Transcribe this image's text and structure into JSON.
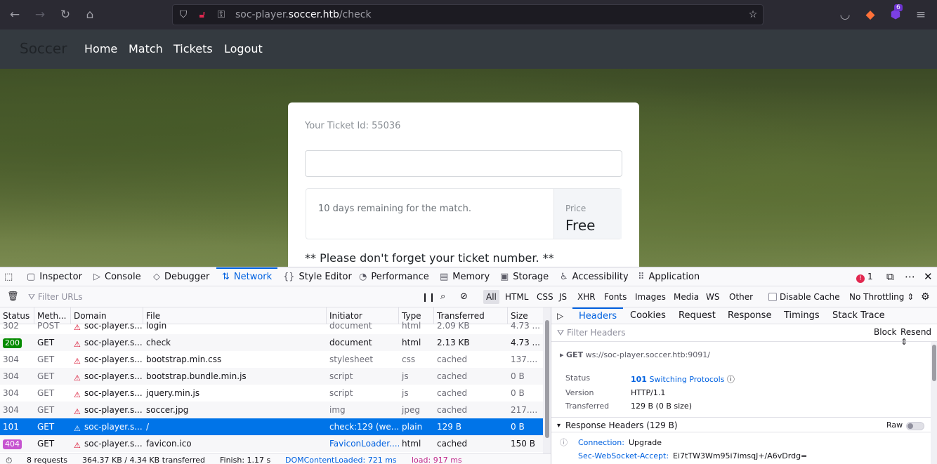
{
  "browser": {
    "url_prefix": "soc-player.",
    "url_domain": "soccer.htb",
    "url_path": "/check",
    "extension_badge": "6"
  },
  "site": {
    "brand": "Soccer",
    "nav": [
      "Home",
      "Match",
      "Tickets",
      "Logout"
    ],
    "ticket_id_text": "Your Ticket Id: 55036",
    "ticket_input_value": "",
    "remaining_text": "10 days remaining for the match.",
    "price_label": "Price",
    "price_value": "Free",
    "note": "** Please don't forget your ticket number. **"
  },
  "devtools": {
    "tabs": [
      {
        "label": "Inspector",
        "glyph": "▢"
      },
      {
        "label": "Console",
        "glyph": "▷"
      },
      {
        "label": "Debugger",
        "glyph": "◇"
      },
      {
        "label": "Network",
        "glyph": "⇅"
      },
      {
        "label": "Style Editor",
        "glyph": "{}"
      },
      {
        "label": "Performance",
        "glyph": "◔"
      },
      {
        "label": "Memory",
        "glyph": "▤"
      },
      {
        "label": "Storage",
        "glyph": "▣"
      },
      {
        "label": "Accessibility",
        "glyph": "♿"
      },
      {
        "label": "Application",
        "glyph": "⠿"
      }
    ],
    "active_tab": "Network",
    "error_count": "1",
    "filter_placeholder": "Filter URLs",
    "type_filters": [
      "All",
      "HTML",
      "CSS",
      "JS",
      "XHR",
      "Fonts",
      "Images",
      "Media",
      "WS",
      "Other"
    ],
    "disable_cache_label": "Disable Cache",
    "throttling": "No Throttling",
    "columns": [
      "Status",
      "Meth...",
      "Domain",
      "File",
      "Initiator",
      "Type",
      "Transferred",
      "Size"
    ],
    "requests": [
      {
        "status": "302",
        "method": "POST",
        "domain": "soc-player.s...",
        "file": "login",
        "initiator": "document",
        "type": "html",
        "transferred": "2.09 KB",
        "size": "4.73 ..."
      },
      {
        "status": "200",
        "method": "GET",
        "domain": "soc-player.s...",
        "file": "check",
        "initiator": "document",
        "type": "html",
        "transferred": "2.13 KB",
        "size": "4.73 ..."
      },
      {
        "status": "304",
        "method": "GET",
        "domain": "soc-player.s...",
        "file": "bootstrap.min.css",
        "initiator": "stylesheet",
        "type": "css",
        "transferred": "cached",
        "size": "137...."
      },
      {
        "status": "304",
        "method": "GET",
        "domain": "soc-player.s...",
        "file": "bootstrap.bundle.min.js",
        "initiator": "script",
        "type": "js",
        "transferred": "cached",
        "size": "0 B"
      },
      {
        "status": "304",
        "method": "GET",
        "domain": "soc-player.s...",
        "file": "jquery.min.js",
        "initiator": "script",
        "type": "js",
        "transferred": "cached",
        "size": "0 B"
      },
      {
        "status": "304",
        "method": "GET",
        "domain": "soc-player.s...",
        "file": "soccer.jpg",
        "initiator": "img",
        "type": "jpeg",
        "transferred": "cached",
        "size": "217...."
      },
      {
        "status": "101",
        "method": "GET",
        "domain": "soc-player.s...",
        "file": "/",
        "initiator": "check:129 (we...",
        "type": "plain",
        "transferred": "129 B",
        "size": "0 B"
      },
      {
        "status": "404",
        "method": "GET",
        "domain": "soc-player.s...",
        "file": "favicon.ico",
        "initiator": "FaviconLoader....",
        "type": "html",
        "transferred": "cached",
        "size": "150 B"
      }
    ],
    "status_bar": {
      "requests": "8 requests",
      "transferred": "364.37 KB / 4.34 KB transferred",
      "finish": "Finish: 1.17 s",
      "dcl": "DOMContentLoaded: 721 ms",
      "load": "load: 917 ms"
    },
    "panel": {
      "tabs": [
        "Headers",
        "Cookies",
        "Request",
        "Response",
        "Timings",
        "Stack Trace"
      ],
      "filter_placeholder": "Filter Headers",
      "block_label": "Block",
      "resend_label": "Resend",
      "method": "GET",
      "url": "ws://soc-player.soccer.htb:9091/",
      "status_label": "Status",
      "status_code": "101",
      "status_text": "Switching Protocols",
      "version_label": "Version",
      "version_value": "HTTP/1.1",
      "transferred_label": "Transferred",
      "transferred_value": "129 B (0 B size)",
      "response_headers_title": "Response Headers (129 B)",
      "raw_label": "Raw",
      "headers": [
        {
          "name": "Connection:",
          "value": "Upgrade"
        },
        {
          "name": "Sec-WebSocket-Accept:",
          "value": "Ei7tTW3Wm95i7imsqJ+/A6vDrdg="
        }
      ]
    }
  },
  "colors": {
    "accent": "#0061e0",
    "selected_row": "#0074e8",
    "status_200": "#058b00",
    "status_404": "#c654d0",
    "error": "#e22850"
  }
}
